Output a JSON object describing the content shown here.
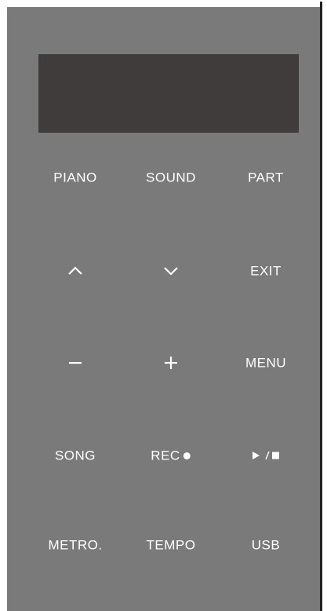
{
  "buttons": {
    "piano": "PIANO",
    "sound": "SOUND",
    "part": "PART",
    "exit": "EXIT",
    "menu": "MENU",
    "song": "SONG",
    "rec": "REC",
    "metro": "METRO.",
    "tempo": "TEMPO",
    "usb": "USB"
  },
  "icons": {
    "up": "chevron-up-icon",
    "down": "chevron-down-icon",
    "minus": "minus-icon",
    "plus": "plus-icon",
    "rec_dot": "record-dot-icon",
    "play_stop": "play-stop-icon"
  },
  "colors": {
    "panel": "#7a7a7a",
    "display": "#3f3c3b",
    "label": "#ffffff"
  }
}
